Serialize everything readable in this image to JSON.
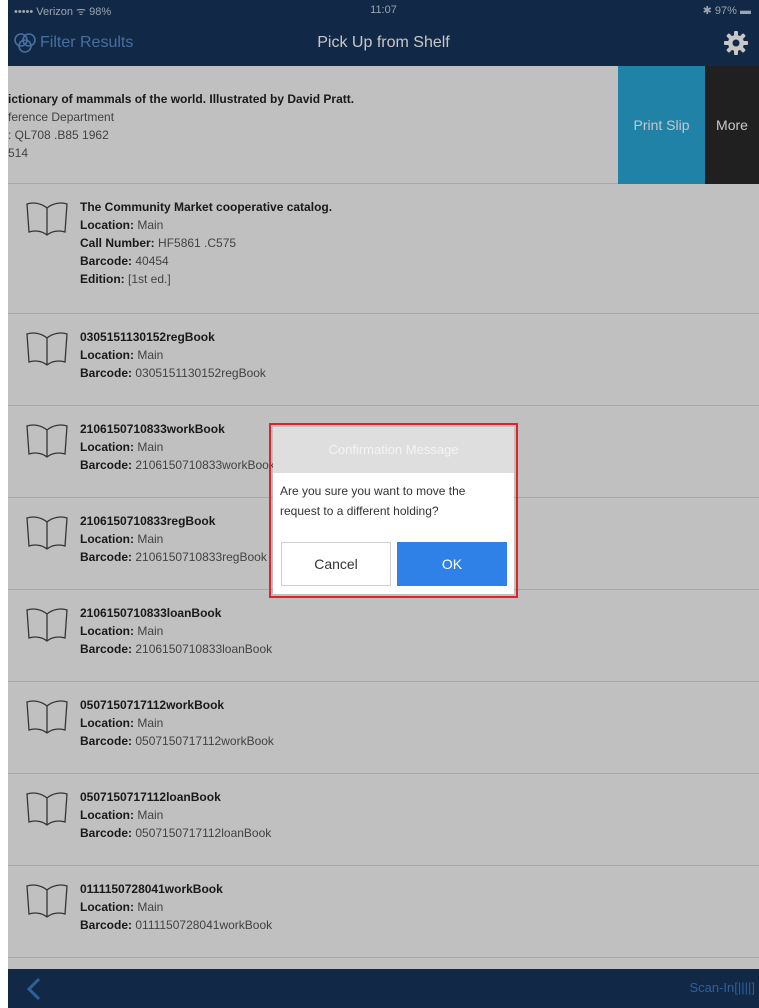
{
  "status_bar": {
    "carrier": "••••• Verizon ᯤ 98%",
    "time": "11:07",
    "battery": "✱ 97% ▬"
  },
  "nav": {
    "filter_label": "Filter Results",
    "title": "Pick Up from Shelf",
    "filter_icon": "filter-icon",
    "settings_icon": "gear-icon"
  },
  "swiped_item": {
    "line1": "ictionary of mammals of the world. Illustrated by David Pratt.",
    "line2": "ference Department",
    "line3": ": QL708 .B85 1962",
    "line4": "514",
    "print_label": "Print Slip",
    "more_label": "More"
  },
  "labels": {
    "location": "Location:",
    "call_number": "Call Number:",
    "barcode": "Barcode:",
    "edition": "Edition:"
  },
  "items": [
    {
      "title": "The Community Market cooperative catalog.",
      "location": "Main",
      "call_number": "HF5861 .C575",
      "barcode": "40454",
      "edition": "[1st ed.]"
    },
    {
      "title": "0305151130152regBook",
      "location": "Main",
      "barcode": "0305151130152regBook"
    },
    {
      "title": "2106150710833workBook",
      "location": "Main",
      "barcode": "2106150710833workBook"
    },
    {
      "title": "2106150710833regBook",
      "location": "Main",
      "barcode": "2106150710833regBook"
    },
    {
      "title": "2106150710833loanBook",
      "location": "Main",
      "barcode": "2106150710833loanBook"
    },
    {
      "title": "0507150717112workBook",
      "location": "Main",
      "barcode": "0507150717112workBook"
    },
    {
      "title": "0507150717112loanBook",
      "location": "Main",
      "barcode": "0507150717112loanBook"
    },
    {
      "title": "0111150728041workBook",
      "location": "Main",
      "barcode": "0111150728041workBook"
    }
  ],
  "dialog": {
    "title": "Confirmation Message",
    "message": "Are you sure you want to move the request to a different holding?",
    "cancel_label": "Cancel",
    "ok_label": "OK"
  },
  "bottom": {
    "back_icon": "chevron-left-icon",
    "scan_label": "Scan-In[||||]"
  },
  "colors": {
    "nav_bg": "#16345a",
    "print_slip": "#2aa7d7",
    "more": "#2a2a2a",
    "ok_button": "#2f80e7",
    "highlight": "#e0212e"
  }
}
